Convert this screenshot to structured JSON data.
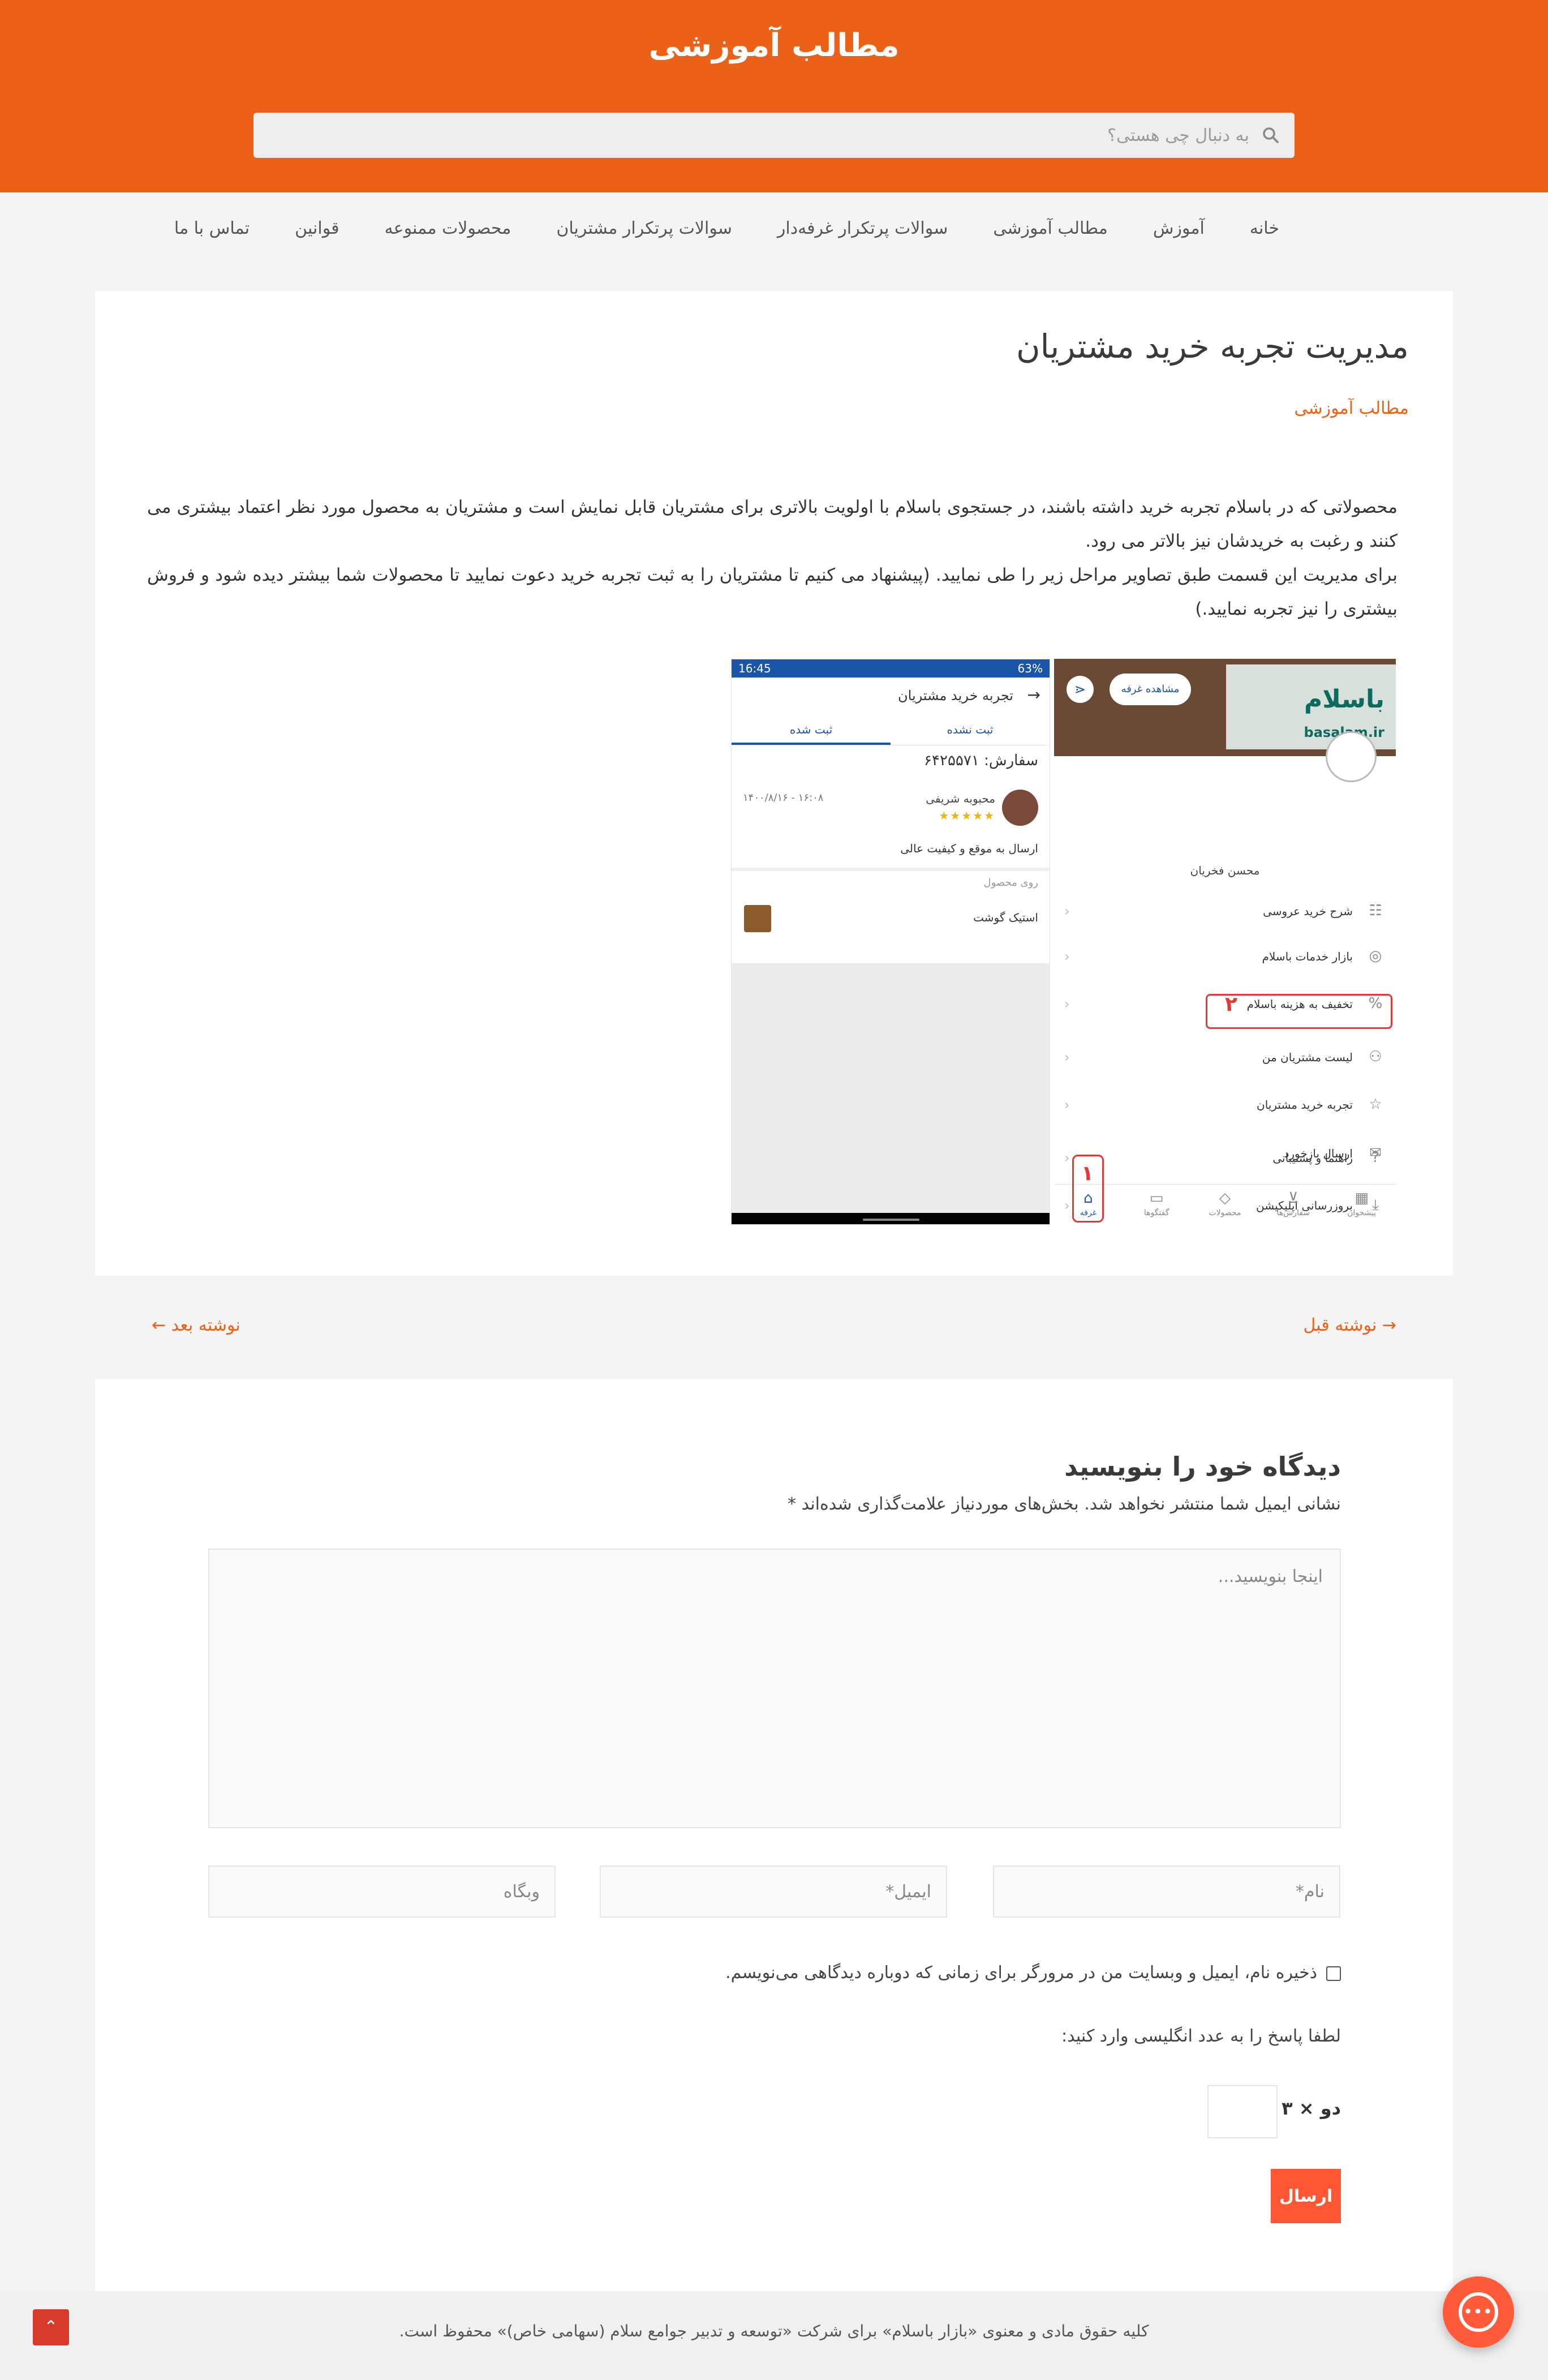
{
  "site": {
    "title": "مطالب آموزشی"
  },
  "search": {
    "placeholder": "به دنبال چی هستی؟"
  },
  "nav": {
    "items": [
      "خانه",
      "آموزش",
      "مطالب آموزشی",
      "سوالات پرتکرار غرفه‌دار",
      "سوالات پرتکرار مشتریان",
      "محصولات ممنوعه",
      "قوانین",
      "تماس با ما"
    ]
  },
  "post": {
    "title": "مدیریت تجربه خرید مشتریان",
    "category": "مطالب آموزشی",
    "paragraph1": "محصولاتی که در باسلام تجربه خرید داشته باشند، در جستجوی باسلام با اولویت بالاتری برای مشتریان قابل نمایش است و مشتریان به محصول مورد نظر اعتماد بیشتری می کنند و رغبت به خریدشان نیز بالاتر می رود.",
    "paragraph2": "برای مدیریت این قسمت طبق تصاویر مراحل زیر را طی نمایید. (پیشنهاد می کنیم تا مشتریان را به ثبت تجربه خرید دعوت نمایید تا محصولات شما بیشتر دیده شود و فروش بیشتری را نیز تجربه نمایید.)"
  },
  "screenshot_left": {
    "time": "16:45",
    "battery": "63%",
    "title": "تجربه خرید مشتریان",
    "tabs": [
      "ثبت نشده",
      "ثبت شده"
    ],
    "order_number": "سفارش: ۶۴۲۵۵۷۱",
    "customer_name": "محبوبه شریفی",
    "date": "۱۴۰۰/۸/۱۶ - ۱۶:۰۸",
    "stars": "★★★★★",
    "comment": "ارسال به موقع و کیفیت عالی",
    "product_label": "روی محصول",
    "product_name": "استیک گوشت"
  },
  "screenshot_right": {
    "logo": "باسلام",
    "logo_en": "basalam.ir",
    "cta": "مشاهده غرفه",
    "profile_name": "محسن فخریان",
    "menu": [
      "شرح خرید عروسی",
      "بازار خدمات باسلام",
      "تخفیف به هزینه باسلام",
      "لیست مشتریان من",
      "تجربه خرید مشتریان",
      "راهنما و پشتیبانی",
      "بروزرسانی اپلیکیشن",
      "ارسال بازخورد"
    ],
    "step1": "۱",
    "step2": "۲",
    "bottom_nav": [
      "پیشخوان",
      "سفارش‌ها",
      "محصولات",
      "گفتگوها",
      "غرفه"
    ]
  },
  "post_nav": {
    "previous": "→ نوشته قبل",
    "next": "نوشته بعد ←"
  },
  "comments": {
    "title": "دیدگاه خود را بنویسید",
    "notes": "نشانی ایمیل شما منتشر نخواهد شد. بخش‌های موردنیاز علامت‌گذاری شده‌اند *",
    "textarea_placeholder": "اینجا بنویسید...",
    "name_placeholder": "نام*",
    "email_placeholder": "ایمیل*",
    "website_placeholder": "وبگاه",
    "consent": "ذخیره نام، ایمیل و وبسایت من در مرورگر برای زمانی که دوباره دیدگاهی می‌نویسم.",
    "captcha_prompt": "لطفا پاسخ را به عدد انگلیسی وارد کنید:",
    "captcha_question": "دو × ۳ =",
    "submit": "ارسال"
  },
  "footer": {
    "copyright": "کلیه حقوق مادی و معنوی «بازار باسلام» برای شرکت «توسعه و تدبیر جوامع سلام (سهامی خاص)» محفوظ است."
  },
  "colors": {
    "brand": "#eb6118",
    "button": "#ff5733",
    "highlight": "#e53935",
    "app_blue": "#1b55a9"
  },
  "icons": {
    "search": "search-icon",
    "back_to_top": "arrow-up-icon",
    "chat": "chat-icon"
  }
}
